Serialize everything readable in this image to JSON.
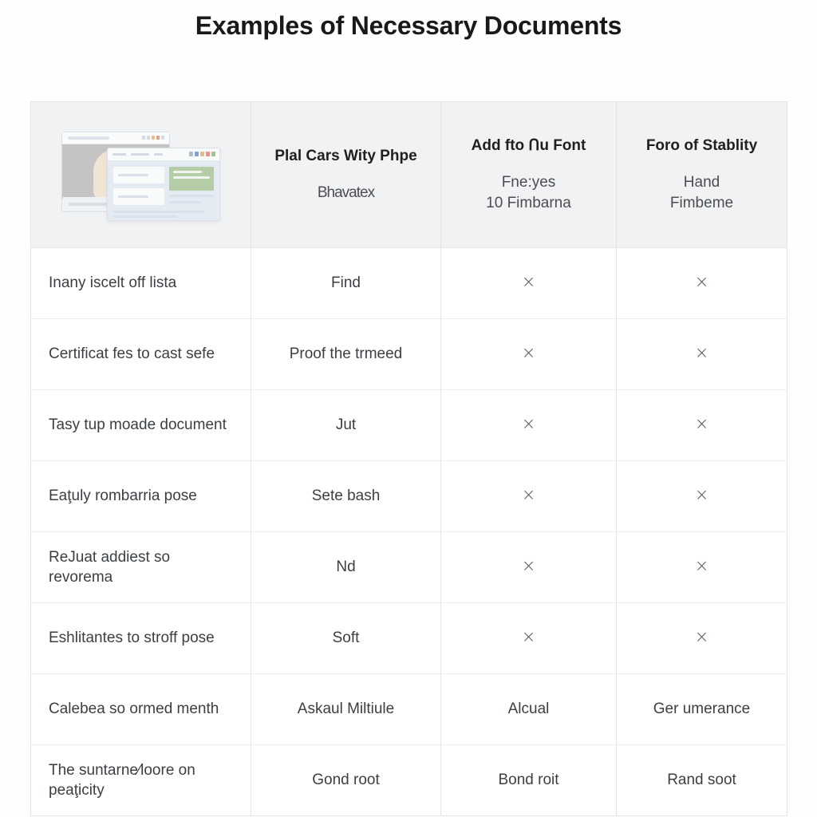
{
  "document": {
    "title": "Examples of Necessary Documents"
  },
  "illustration": {
    "name": "documents-windows-illustration",
    "description": "two overlapping browser windows with an id photo and a form"
  },
  "table": {
    "headers": [
      {
        "title": "",
        "subtitle": "",
        "subtitle2": "",
        "is_illustration": true
      },
      {
        "title": "Plal Cars Wity Phpe",
        "subtitle": "Bhavatex",
        "subtitle2": ""
      },
      {
        "title": "Add fto Ոu Font",
        "subtitle": "Fne:yes",
        "subtitle2": "10 Fimbarna"
      },
      {
        "title": "Foro of Stablity",
        "subtitle": "Hand",
        "subtitle2": "Fimbeme"
      }
    ],
    "rows": [
      {
        "label": "Inany iscelt off lista",
        "c2": "Find",
        "c3": "×",
        "c4": "×"
      },
      {
        "label": "Certificat fes to cast sefe",
        "c2": "Proof the trmeed",
        "c3": "×",
        "c4": "×"
      },
      {
        "label": "Tasy tup moade document",
        "c2": "Jut",
        "c3": "×",
        "c4": "×"
      },
      {
        "label": "Eaţuly rombarria pose",
        "c2": "Sete bash",
        "c3": "×",
        "c4": "×"
      },
      {
        "label": "ReJuat addiest so revorema",
        "c2": "Nd",
        "c3": "×",
        "c4": "×"
      },
      {
        "label": "Eshlitantes to stroff pose",
        "c2": "Soft",
        "c3": "×",
        "c4": "×"
      },
      {
        "label": "Calebea so ormed menth",
        "c2": "Askaul Miltiule",
        "c3": "Alcual",
        "c4": "Ger umerance"
      },
      {
        "label": "The suntarne⁄loore on peaţicity",
        "c2": "Gond root",
        "c3": "Bond roit",
        "c4": "Rand soot"
      }
    ]
  },
  "colors": {
    "header_bg": "#f1f2f3",
    "border": "#e3e5e7",
    "text": "#3b3f44",
    "title": "#18191b",
    "accent_green": "#8fb878"
  }
}
